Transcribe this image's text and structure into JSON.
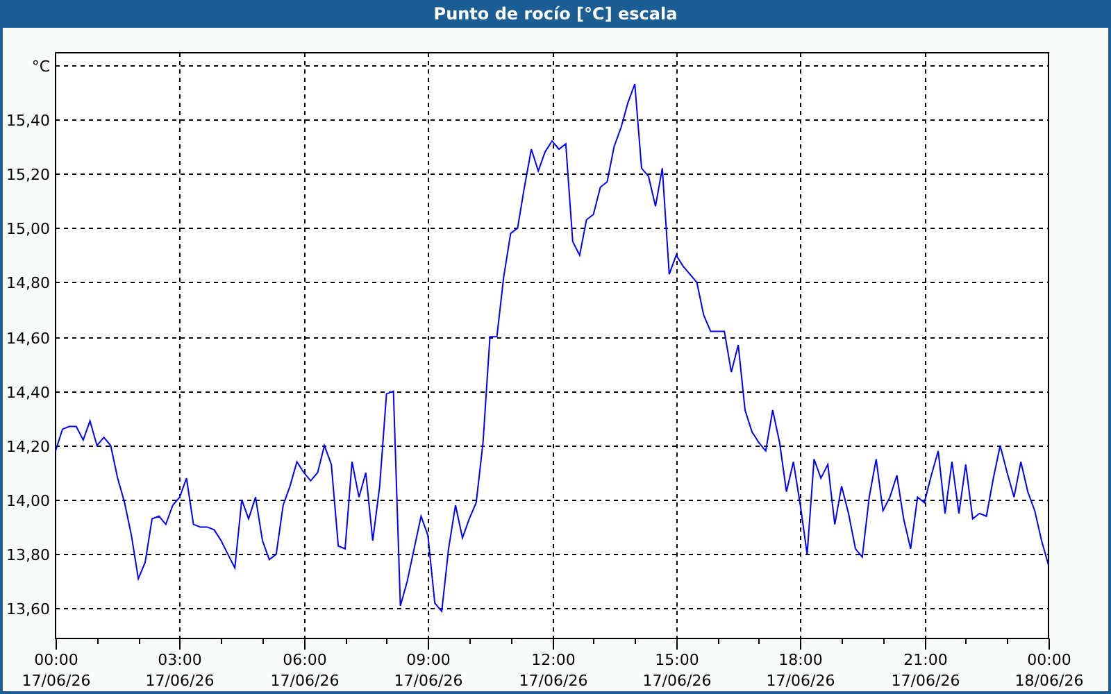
{
  "window": {
    "title": "Punto de rocío [°C] escala"
  },
  "chart": {
    "chart_data": {
      "type": "line",
      "grid": true,
      "ylim": [
        13.49,
        15.645
      ],
      "yticks": [
        {
          "value": 13.6,
          "label": "13,60"
        },
        {
          "value": 13.8,
          "label": "13,80"
        },
        {
          "value": 14.0,
          "label": "14,00"
        },
        {
          "value": 14.2,
          "label": "14,20"
        },
        {
          "value": 14.4,
          "label": "14,40"
        },
        {
          "value": 14.6,
          "label": "14,60"
        },
        {
          "value": 14.8,
          "label": "14,80"
        },
        {
          "value": 15.0,
          "label": "15,00"
        },
        {
          "value": 15.2,
          "label": "15,20"
        },
        {
          "value": 15.4,
          "label": "15,40"
        },
        {
          "value": 15.6,
          "label": "°C"
        }
      ],
      "categories": [
        "00:00\n17/06/26",
        null,
        null,
        null,
        null,
        null,
        null,
        null,
        null,
        null,
        null,
        null,
        null,
        null,
        null,
        null,
        null,
        null,
        "03:00\n17/06/26",
        null,
        null,
        null,
        null,
        null,
        null,
        null,
        null,
        null,
        null,
        null,
        null,
        null,
        null,
        null,
        null,
        null,
        "06:00\n17/06/26",
        null,
        null,
        null,
        null,
        null,
        null,
        null,
        null,
        null,
        null,
        null,
        null,
        null,
        null,
        null,
        null,
        null,
        "09:00\n17/06/26",
        null,
        null,
        null,
        null,
        null,
        null,
        null,
        null,
        null,
        null,
        null,
        null,
        null,
        null,
        null,
        null,
        null,
        "12:00\n17/06/26",
        null,
        null,
        null,
        null,
        null,
        null,
        null,
        null,
        null,
        null,
        null,
        null,
        null,
        null,
        null,
        null,
        null,
        "15:00\n17/06/26",
        null,
        null,
        null,
        null,
        null,
        null,
        null,
        null,
        null,
        null,
        null,
        null,
        null,
        null,
        null,
        null,
        null,
        "18:00\n17/06/26",
        null,
        null,
        null,
        null,
        null,
        null,
        null,
        null,
        null,
        null,
        null,
        null,
        null,
        null,
        null,
        null,
        null,
        "21:00\n17/06/26",
        null,
        null,
        null,
        null,
        null,
        null,
        null,
        null,
        null,
        null,
        null,
        null,
        null,
        null,
        null,
        null,
        null,
        "00:00\n18/06/26"
      ],
      "series": [
        {
          "color": "#0000ff",
          "values": [
            14.18,
            14.26,
            14.27,
            14.27,
            14.22,
            14.29,
            14.2,
            14.23,
            14.2,
            14.08,
            13.99,
            13.87,
            13.71,
            13.77,
            13.93,
            13.94,
            13.91,
            13.98,
            14.01,
            14.08,
            13.91,
            13.9,
            13.9,
            13.89,
            13.85,
            13.8,
            13.75,
            14.0,
            13.93,
            14.01,
            13.85,
            13.78,
            13.8,
            13.98,
            14.05,
            14.14,
            14.1,
            14.07,
            14.1,
            14.2,
            14.13,
            13.83,
            13.82,
            14.14,
            14.01,
            14.1,
            13.85,
            14.05,
            14.39,
            14.4,
            13.61,
            13.7,
            13.82,
            13.94,
            13.87,
            13.62,
            13.59,
            13.82,
            13.98,
            13.86,
            13.93,
            13.99,
            14.21,
            14.6,
            14.6,
            14.82,
            14.98,
            15.0,
            15.15,
            15.29,
            15.21,
            15.28,
            15.32,
            15.29,
            15.31,
            14.95,
            14.9,
            15.03,
            15.05,
            15.15,
            15.17,
            15.3,
            15.37,
            15.46,
            15.53,
            15.22,
            15.19,
            15.08,
            15.22,
            14.83,
            14.9,
            14.86,
            14.83,
            14.8,
            14.68,
            14.62,
            14.62,
            14.62,
            14.47,
            14.57,
            14.33,
            14.25,
            14.21,
            14.18,
            14.33,
            14.21,
            14.03,
            14.14,
            13.98,
            13.8,
            14.15,
            14.08,
            14.13,
            13.91,
            14.05,
            13.95,
            13.82,
            13.79,
            14.01,
            14.15,
            13.96,
            14.01,
            14.09,
            13.93,
            13.82,
            14.01,
            13.99,
            14.09,
            14.18,
            13.95,
            14.14,
            13.95,
            14.13,
            13.93,
            13.95,
            13.94,
            14.08,
            14.2,
            14.1,
            14.01,
            14.14,
            14.03,
            13.96,
            13.85,
            13.76
          ]
        }
      ]
    }
  }
}
